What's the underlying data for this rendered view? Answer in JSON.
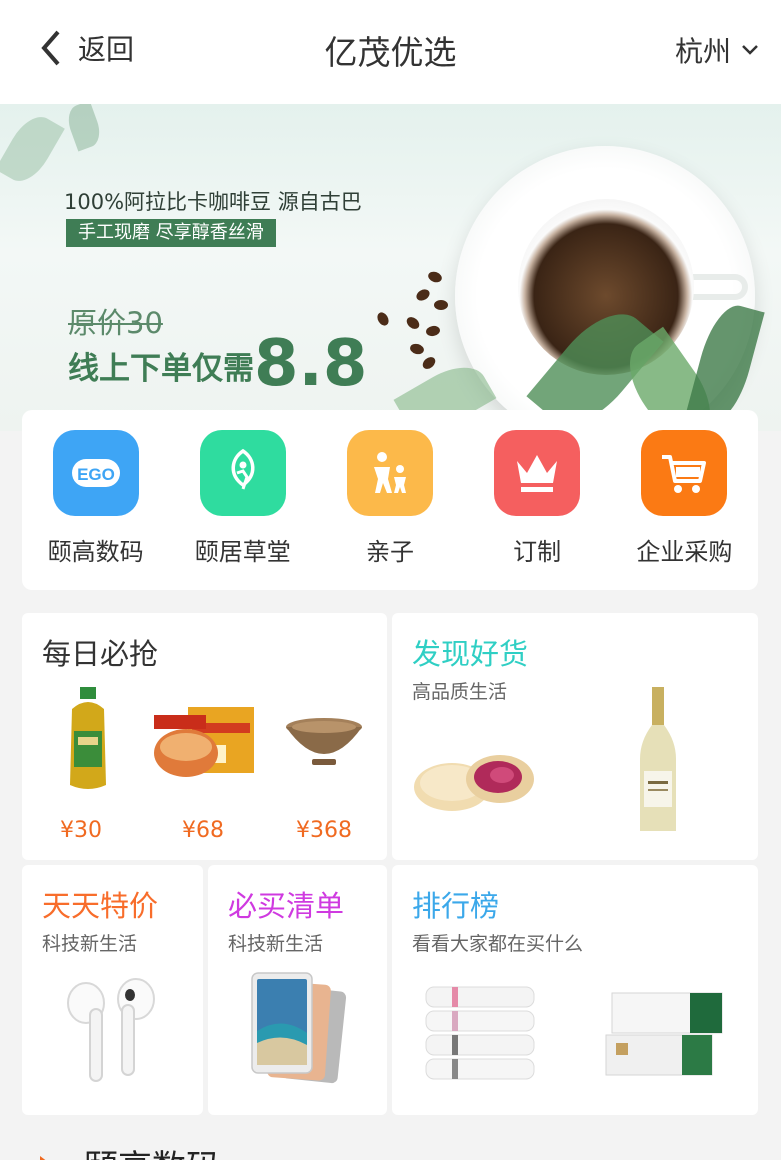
{
  "header": {
    "back_label": "返回",
    "title": "亿茂优选",
    "city": "杭州"
  },
  "banner": {
    "line1": "100%阿拉比卡咖啡豆 源自古巴",
    "tag": "手工现磨 尽享醇香丝滑",
    "original_price": "原价30",
    "promo_text": "线上下单仅需",
    "promo_price": "8.8"
  },
  "categories": [
    {
      "label": "颐高数码",
      "icon": "ego-logo-icon",
      "color": "#3ea5f5"
    },
    {
      "label": "颐居草堂",
      "icon": "leaf-person-icon",
      "color": "#2fdc9f"
    },
    {
      "label": "亲子",
      "icon": "family-icon",
      "color": "#fcb94a"
    },
    {
      "label": "订制",
      "icon": "crown-icon",
      "color": "#f55f5f"
    },
    {
      "label": "企业采购",
      "icon": "shopping-cart-icon",
      "color": "#fb7a14"
    }
  ],
  "daily": {
    "title": "每日必抢",
    "prices": [
      "¥30",
      "¥68",
      "¥368"
    ]
  },
  "discover": {
    "title": "发现好货",
    "subtitle": "高品质生活",
    "title_color": "#2fcfc4"
  },
  "everyday": {
    "title": "天天特价",
    "subtitle": "科技新生活",
    "title_color": "#f86d2b"
  },
  "mustbuy": {
    "title": "必买清单",
    "subtitle": "科技新生活",
    "title_color": "#cf3ae0"
  },
  "ranking": {
    "title": "排行榜",
    "subtitle": "看看大家都在买什么",
    "title_color": "#3ba8ea"
  },
  "section": {
    "title": "颐高数码"
  }
}
